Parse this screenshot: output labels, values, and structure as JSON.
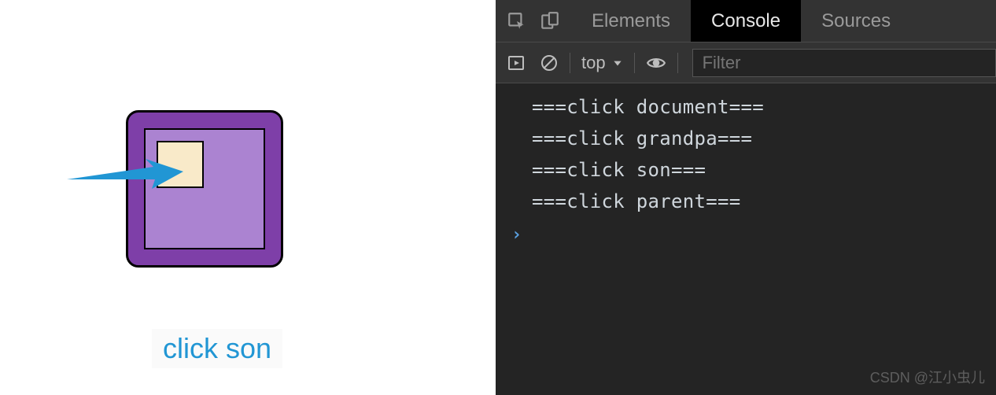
{
  "left": {
    "caption": "click son"
  },
  "devtools": {
    "tabs": {
      "elements": "Elements",
      "console": "Console",
      "sources": "Sources"
    },
    "toolbar": {
      "context": "top",
      "filter_placeholder": "Filter"
    },
    "console_lines": [
      "===click document===",
      "===click grandpa===",
      "===click son===",
      "===click parent==="
    ],
    "prompt": "›"
  },
  "watermark": "CSDN @江小虫儿"
}
